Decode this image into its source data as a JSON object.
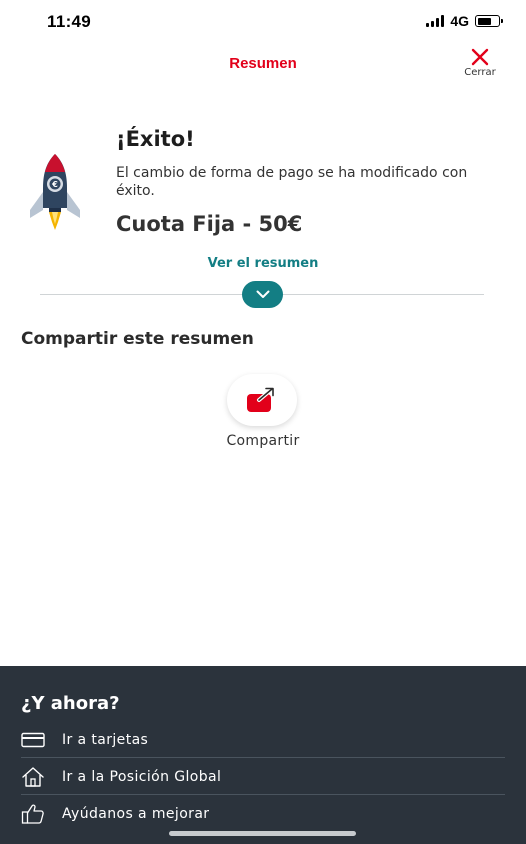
{
  "status_bar": {
    "time": "11:49",
    "network": "4G"
  },
  "header": {
    "title": "Resumen",
    "close_label": "Cerrar"
  },
  "success": {
    "title": "¡Éxito!",
    "message": "El cambio de forma de pago se ha modificado con éxito.",
    "amount": "Cuota Fija - 50€"
  },
  "summary_link": "Ver el resumen",
  "share": {
    "heading": "Compartir este resumen",
    "button_label": "Compartir"
  },
  "next_steps": {
    "title": "¿Y ahora?",
    "items": [
      {
        "label": "Ir a tarjetas",
        "icon": "card-icon"
      },
      {
        "label": "Ir a la Posición Global",
        "icon": "home-icon"
      },
      {
        "label": "Ayúdanos a mejorar",
        "icon": "thumbs-up-icon"
      }
    ]
  },
  "colors": {
    "brand_red": "#e2001a",
    "accent_teal": "#137e84",
    "panel_dark": "#2b333c"
  }
}
